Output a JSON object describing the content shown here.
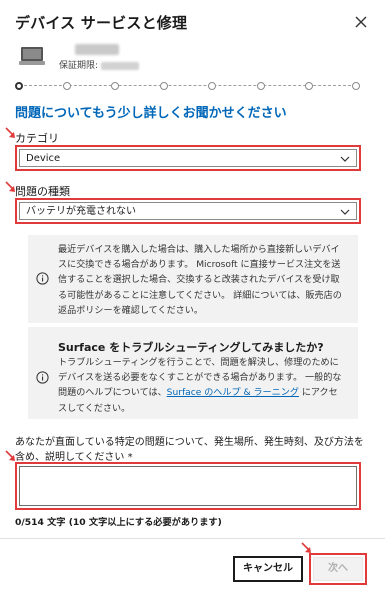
{
  "dialog": {
    "title": "デバイス サービスと修理",
    "close_icon": "close-icon"
  },
  "device": {
    "warranty_label": "保証期限:",
    "thumb_icon": "surface-device-icon"
  },
  "progress": {
    "total_steps": 8,
    "current_step": 1
  },
  "form": {
    "heading": "問題についてもう少し詳しくお聞かせください",
    "category": {
      "label": "カテゴリ",
      "value": "Device"
    },
    "problem_type": {
      "label": "問題の種類",
      "value": "バッテリが充電されない"
    },
    "description": {
      "label": "あなたが直面している特定の問題について、発生場所、発生時刻、及び方法を含め、説明してください *",
      "value": "",
      "counter": "0/514 文字 (10 文字以上にする必要があります)"
    }
  },
  "notices": {
    "purchase": {
      "text": "最近デバイスを購入した場合は、購入した場所から直接新しいデバイスに交換できる場合があります。 Microsoft に直接サービス注文を送信することを選択した場合、交換すると改装されたデバイスを受け取る可能性があることに注意してください。 詳細については、販売店の返品ポリシーを確認してください。"
    },
    "troubleshoot": {
      "title": "Surface をトラブルシューティングしてみましたか?",
      "text_before": "トラブルシューティングを行うことで、問題を解決し、修理のためにデバイスを送る必要をなくすことができる場合があります。 一般的な問題のヘルプについては、",
      "link": "Surface のヘルプ & ラーニング",
      "text_after": " にアクセスしてください。"
    }
  },
  "buttons": {
    "cancel": "キャンセル",
    "next": "次へ"
  },
  "colors": {
    "accent": "#0067b8",
    "highlight": "#e03a3a",
    "notice_bg": "#f2f2f2"
  }
}
